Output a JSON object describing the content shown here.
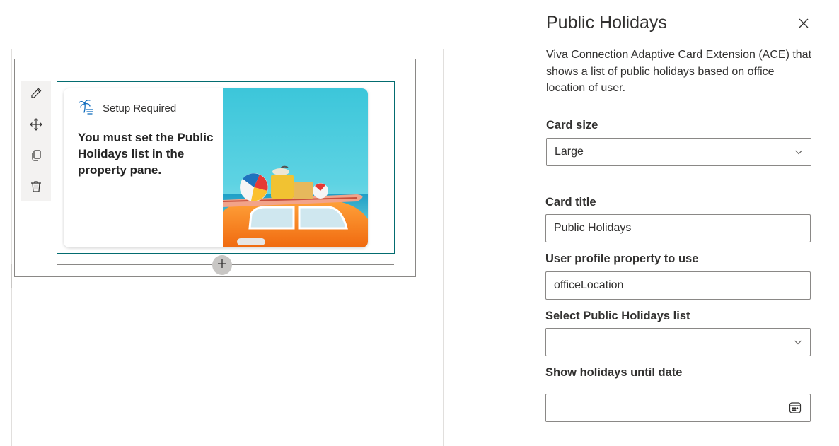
{
  "webpart": {
    "toolbar": {
      "icons": [
        "edit-icon",
        "move-icon",
        "duplicate-icon",
        "delete-icon"
      ]
    },
    "card": {
      "header_title": "Setup Required",
      "body_text": "You must set the Public Holidays list in the property pane.",
      "app_icon": "palm-tree-icon",
      "image_subject": "car with beach luggage on roof"
    },
    "add_button_icon": "plus-icon"
  },
  "property_pane": {
    "title": "Public Holidays",
    "close_icon": "close-icon",
    "description": "Viva Connection Adaptive Card Extension (ACE) that shows a list of public holidays based on office location of user.",
    "fields": {
      "card_size": {
        "label": "Card size",
        "value": "Large"
      },
      "card_title": {
        "label": "Card title",
        "value": "Public Holidays"
      },
      "user_profile_property": {
        "label": "User profile property to use",
        "value": "officeLocation"
      },
      "holidays_list": {
        "label": "Select Public Holidays list",
        "value": ""
      },
      "until_date": {
        "label": "Show holidays until date",
        "value": ""
      }
    }
  },
  "colors": {
    "accent_selected": "#036c70",
    "icon_blue": "#0f6cbd",
    "toolbar_bg": "#f3f2f1"
  }
}
